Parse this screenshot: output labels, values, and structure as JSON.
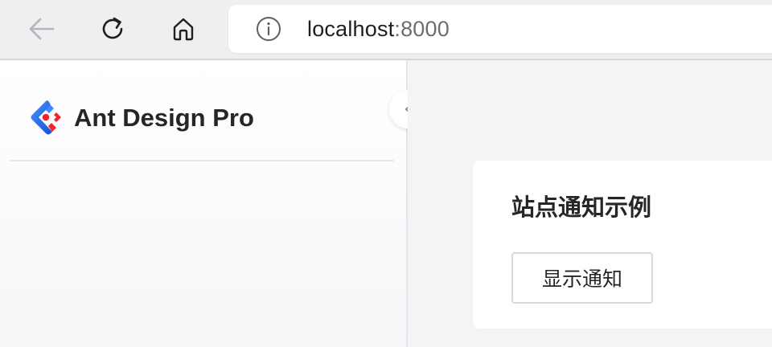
{
  "browser": {
    "url_host": "localhost",
    "url_port": ":8000",
    "icons": {
      "back": "arrow-left-icon",
      "reload": "reload-icon",
      "home": "home-icon",
      "info": "info-icon"
    }
  },
  "sidebar": {
    "brand_title": "Ant Design Pro",
    "logo": "ant-design-logo",
    "collapse_icon": "chevron-left-icon"
  },
  "main": {
    "card": {
      "title": "站点通知示例",
      "button_label": "显示通知"
    }
  },
  "colors": {
    "logo_blue": "#1677ff",
    "logo_red": "#f5222d",
    "text_primary": "#262626",
    "page_background": "#f4f4f6"
  }
}
